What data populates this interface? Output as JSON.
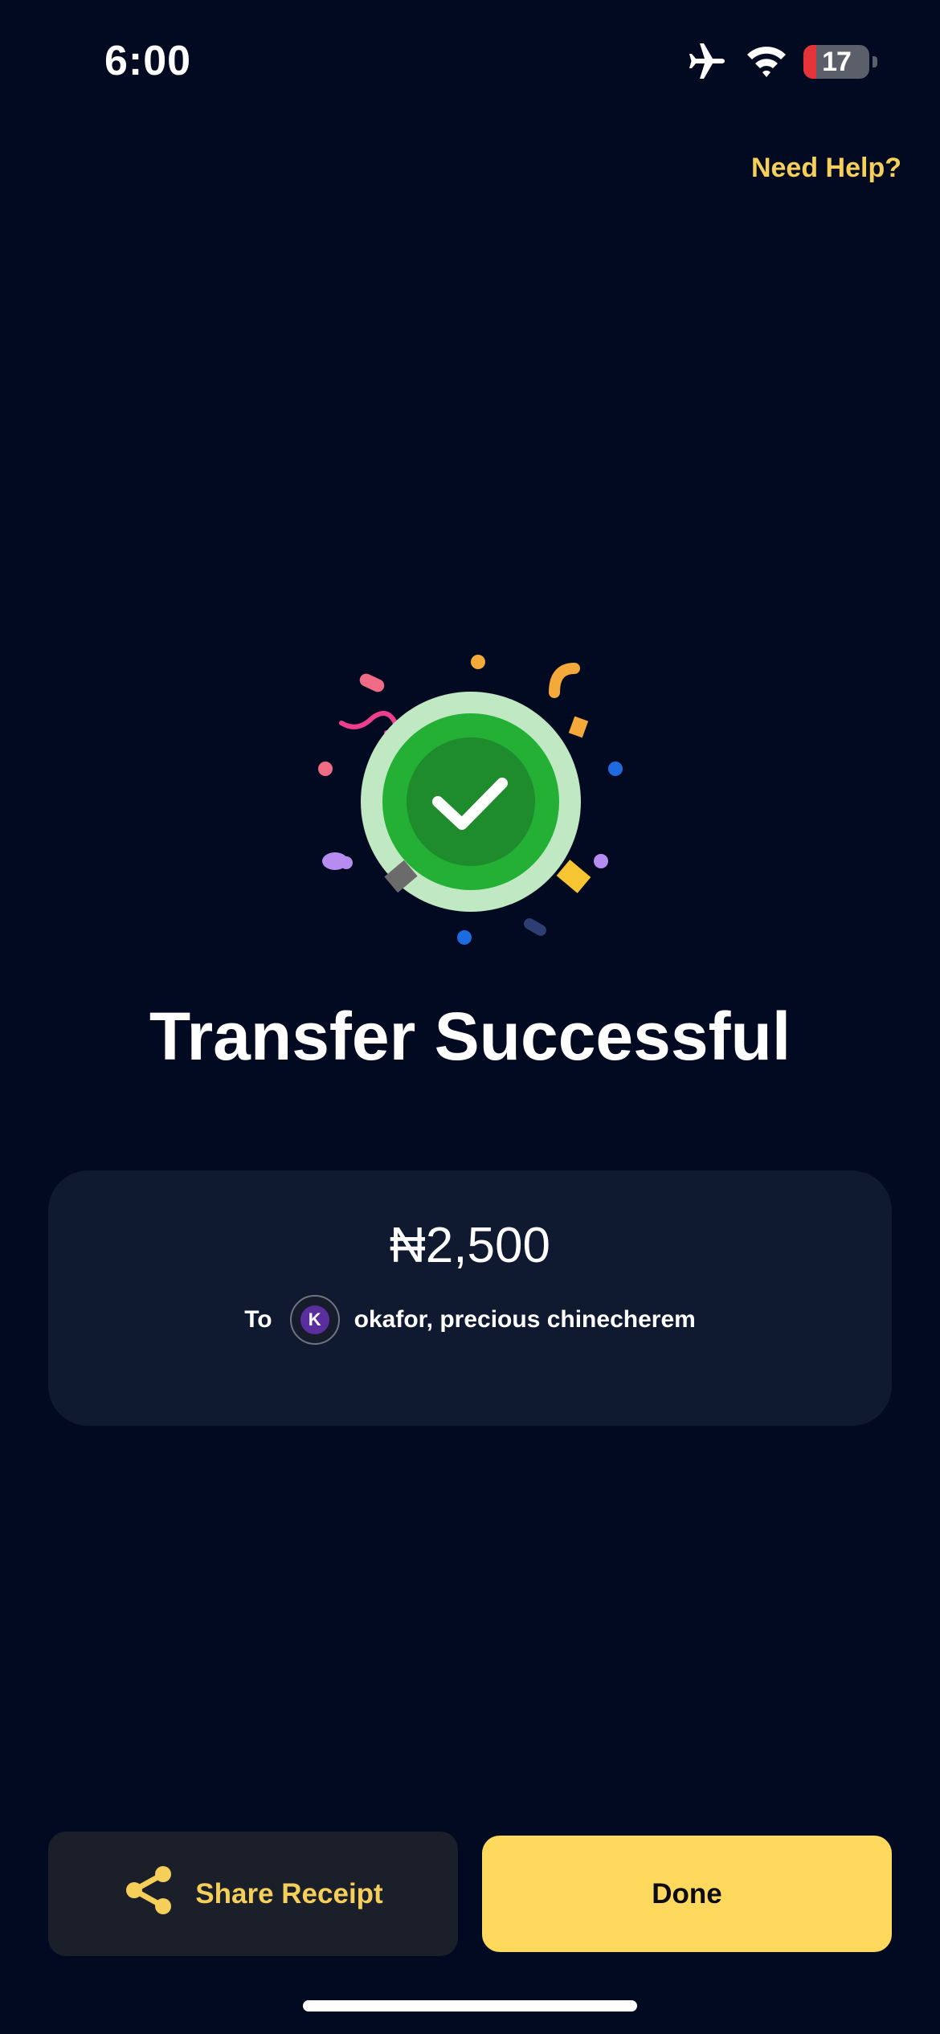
{
  "status_bar": {
    "time": "6:00",
    "battery_level": "17",
    "battery_fraction": 0.17,
    "icons": [
      "airplane-icon",
      "wifi-icon",
      "battery-icon"
    ]
  },
  "header": {
    "help_link": "Need Help?"
  },
  "result": {
    "title": "Transfer Successful",
    "illustration": "success-check-icon"
  },
  "transfer": {
    "amount": "₦2,500",
    "to_label": "To",
    "recipient_name": "okafor, precious chinecherem",
    "recipient_avatar_letter": "K"
  },
  "actions": {
    "share_label": "Share Receipt",
    "done_label": "Done"
  },
  "colors": {
    "background": "#020a21",
    "card": "#0f1a31",
    "accent": "#fed95e",
    "success": "#22b33a"
  }
}
